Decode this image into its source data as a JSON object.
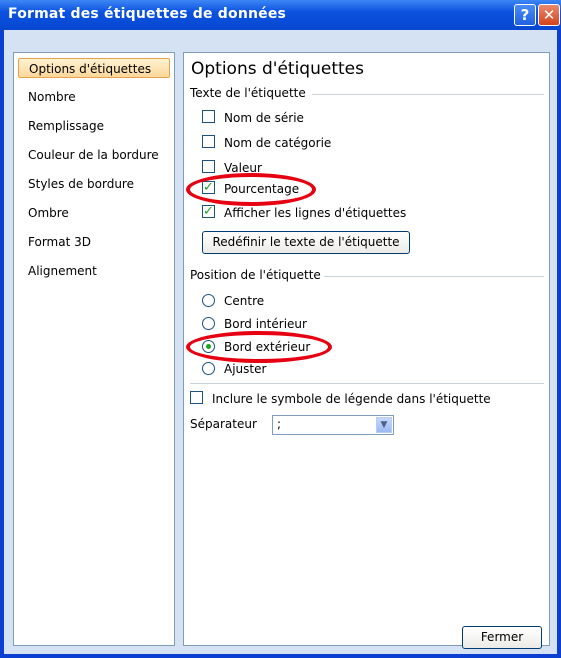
{
  "window": {
    "title": "Format des étiquettes de données",
    "help_glyph": "?",
    "close_glyph": "✕"
  },
  "nav": {
    "items": [
      {
        "label": "Options d'étiquettes",
        "active": true
      },
      {
        "label": "Nombre"
      },
      {
        "label": "Remplissage"
      },
      {
        "label": "Couleur de la bordure"
      },
      {
        "label": "Styles de bordure"
      },
      {
        "label": "Ombre"
      },
      {
        "label": "Format 3D"
      },
      {
        "label": "Alignement"
      }
    ]
  },
  "panel": {
    "title": "Options d'étiquettes",
    "label_text_section": "Texte de l'étiquette",
    "checkboxes": [
      {
        "label": "Nom de série",
        "checked": false
      },
      {
        "label": "Nom de catégorie",
        "checked": false
      },
      {
        "label": "Valeur",
        "checked": false
      },
      {
        "label": "Pourcentage",
        "checked": true
      },
      {
        "label": "Afficher les lignes d'étiquettes",
        "checked": true
      }
    ],
    "reset_button": "Redéfinir le texte de l'étiquette",
    "position_section": "Position de l'étiquette",
    "positions": [
      {
        "label": "Centre",
        "selected": false
      },
      {
        "label": "Bord intérieur",
        "selected": false
      },
      {
        "label": "Bord extérieur",
        "selected": true
      },
      {
        "label": "Ajuster",
        "selected": false
      }
    ],
    "legend_symbol": {
      "label": "Inclure le symbole de légende dans l'étiquette",
      "checked": false
    },
    "separator": {
      "label": "Séparateur",
      "value": ";"
    }
  },
  "footer": {
    "close_button": "Fermer"
  },
  "colors": {
    "title_bar": "#0b52df",
    "highlight": "#e60012",
    "checkmark": "#21a121"
  }
}
